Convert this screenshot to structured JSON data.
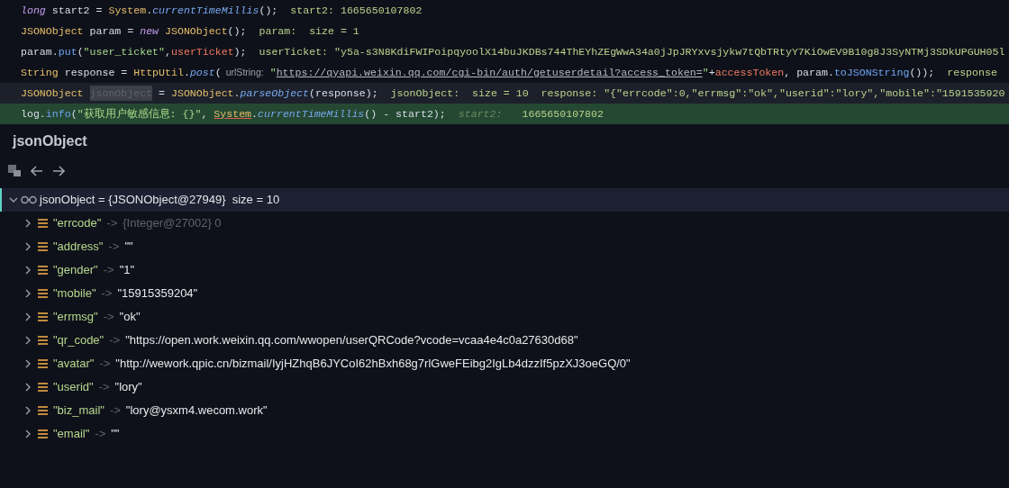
{
  "code_lines": [
    {
      "kind": "normal",
      "tokens": [
        {
          "kind": "keyword",
          "text": "long"
        },
        {
          "kind": "plain",
          "text": " start2 = "
        },
        {
          "kind": "type",
          "text": "System"
        },
        {
          "kind": "plain",
          "text": "."
        },
        {
          "kind": "static_method",
          "text": "currentTimeMillis"
        },
        {
          "kind": "plain",
          "text": "();"
        },
        {
          "kind": "value_hint",
          "text": "start2: 1665650107802"
        }
      ]
    },
    {
      "kind": "normal",
      "tokens": [
        {
          "kind": "type",
          "text": "JSONObject"
        },
        {
          "kind": "plain",
          "text": " param = "
        },
        {
          "kind": "keyword",
          "text": "new"
        },
        {
          "kind": "type",
          "text": " JSONObject"
        },
        {
          "kind": "plain",
          "text": "();"
        },
        {
          "kind": "value_hint",
          "text": "param:  size = 1"
        }
      ]
    },
    {
      "kind": "normal",
      "tokens": [
        {
          "kind": "plain",
          "text": "param."
        },
        {
          "kind": "method",
          "text": "put"
        },
        {
          "kind": "plain",
          "text": "("
        },
        {
          "kind": "string",
          "text": "\"user_ticket\""
        },
        {
          "kind": "plain",
          "text": ","
        },
        {
          "kind": "field",
          "text": "userTicket"
        },
        {
          "kind": "plain",
          "text": ");"
        },
        {
          "kind": "value_hint",
          "text": "userTicket: \"y5a-s3N8KdiFWIPoipqyoolX14buJKDBs744ThEYhZEgWwA34a0jJpJRYxvsjykw7tQbTRtyY7KiOwEV9B10g8J3SyNTMj3SDkUPGUH05l"
        }
      ]
    },
    {
      "kind": "normal",
      "tokens": [
        {
          "kind": "type",
          "text": "String"
        },
        {
          "kind": "plain",
          "text": " response = "
        },
        {
          "kind": "type",
          "text": "HttpUtil"
        },
        {
          "kind": "plain",
          "text": "."
        },
        {
          "kind": "static_method",
          "text": "post"
        },
        {
          "kind": "plain",
          "text": "("
        },
        {
          "kind": "param_hint",
          "text": "urlString:"
        },
        {
          "kind": "string",
          "text": " \""
        },
        {
          "kind": "url",
          "text": "https://qyapi.weixin.qq.com/cgi-bin/auth/getuserdetail?access_token="
        },
        {
          "kind": "string",
          "text": "\""
        },
        {
          "kind": "plain",
          "text": "+"
        },
        {
          "kind": "field",
          "text": "accessToken"
        },
        {
          "kind": "plain",
          "text": ", param."
        },
        {
          "kind": "method",
          "text": "toJSONString"
        },
        {
          "kind": "plain",
          "text": "());"
        },
        {
          "kind": "value_hint",
          "text": "response"
        }
      ]
    },
    {
      "kind": "caret",
      "tokens": [
        {
          "kind": "type",
          "text": "JSONObject "
        },
        {
          "kind": "selection",
          "text": "jsonObject"
        },
        {
          "kind": "plain",
          "text": " = "
        },
        {
          "kind": "type",
          "text": "JSONObject"
        },
        {
          "kind": "plain",
          "text": "."
        },
        {
          "kind": "static_method",
          "text": "parseObject"
        },
        {
          "kind": "plain",
          "text": "(response);"
        },
        {
          "kind": "value_hint",
          "text": "jsonObject:  size = 10  response: \"{\"errcode\":0,\"errmsg\":\"ok\",\"userid\":\"lory\",\"mobile\":\"1591535920"
        }
      ]
    },
    {
      "kind": "execution",
      "tokens": [
        {
          "kind": "plain",
          "text": "log."
        },
        {
          "kind": "method",
          "text": "info"
        },
        {
          "kind": "plain",
          "text": "("
        },
        {
          "kind": "string",
          "text": "\"获取用户敏感信息: {}\""
        },
        {
          "kind": "plain",
          "text": ", "
        },
        {
          "kind": "warning_type",
          "text": "System"
        },
        {
          "kind": "plain",
          "text": "."
        },
        {
          "kind": "static_method",
          "text": "currentTimeMillis"
        },
        {
          "kind": "plain",
          "text": "() - start2);"
        },
        {
          "kind": "dim_hint",
          "text": "start2:"
        },
        {
          "kind": "value_hint",
          "text": "1665650107802"
        }
      ]
    }
  ],
  "panel": {
    "title": "jsonObject"
  },
  "tree": {
    "label": "jsonObject = {JSONObject@27949}  size = 10",
    "expanded": true,
    "selected": true,
    "children": [
      {
        "kind": "object",
        "key": "\"errcode\"",
        "arrow": "->",
        "value": "{Integer@27002} 0",
        "expanded": false
      },
      {
        "kind": "string",
        "key": "\"address\"",
        "arrow": "->",
        "value": "\"\"",
        "expanded": false
      },
      {
        "kind": "string",
        "key": "\"gender\"",
        "arrow": "->",
        "value": "\"1\"",
        "expanded": false
      },
      {
        "kind": "string",
        "key": "\"mobile\"",
        "arrow": "->",
        "value": "\"15915359204\"",
        "expanded": false
      },
      {
        "kind": "string",
        "key": "\"errmsg\"",
        "arrow": "->",
        "value": "\"ok\"",
        "expanded": false
      },
      {
        "kind": "string",
        "key": "\"qr_code\"",
        "arrow": "->",
        "value": "\"https://open.work.weixin.qq.com/wwopen/userQRCode?vcode=vcaa4e4c0a27630d68\"",
        "expanded": false
      },
      {
        "kind": "string",
        "key": "\"avatar\"",
        "arrow": "->",
        "value": "\"http://wework.qpic.cn/bizmail/IyjHZhqB6JYCoI62hBxh68g7rlGweFEibg2IgLb4dzzIf5pzXJ3oeGQ/0\"",
        "expanded": false
      },
      {
        "kind": "string",
        "key": "\"userid\"",
        "arrow": "->",
        "value": "\"lory\"",
        "expanded": false
      },
      {
        "kind": "string",
        "key": "\"biz_mail\"",
        "arrow": "->",
        "value": "\"lory@ysxm4.wecom.work\"",
        "expanded": false
      },
      {
        "kind": "string",
        "key": "\"email\"",
        "arrow": "->",
        "value": "\"\"",
        "expanded": false
      }
    ]
  }
}
